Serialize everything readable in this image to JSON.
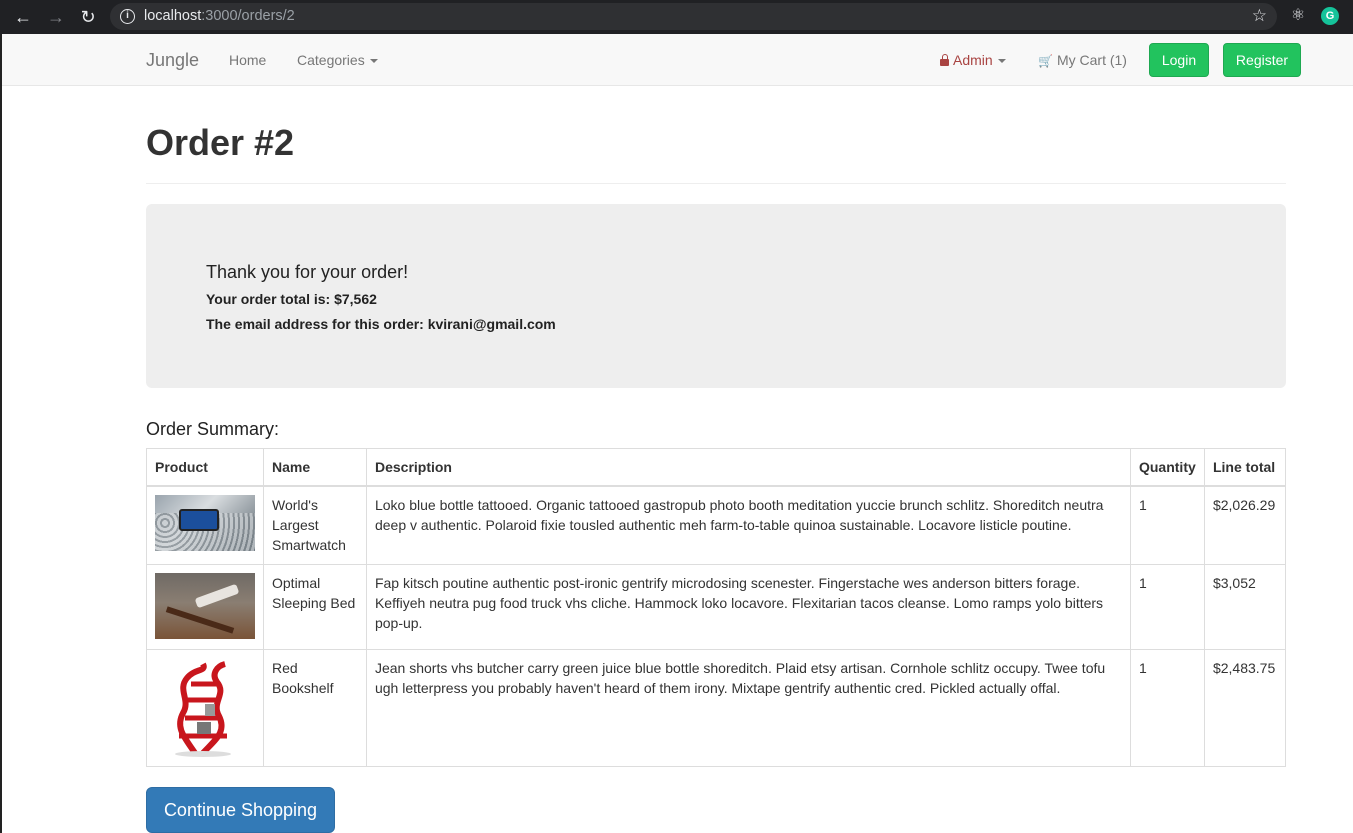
{
  "browser": {
    "url_host": "localhost",
    "url_path": ":3000/orders/2"
  },
  "navbar": {
    "brand": "Jungle",
    "home": "Home",
    "categories": "Categories",
    "admin": "Admin",
    "cart": "My Cart (1)",
    "login": "Login",
    "register": "Register"
  },
  "page": {
    "title": "Order #2"
  },
  "confirmation": {
    "thanks": "Thank you for your order!",
    "total_line": "Your order total is: $7,562",
    "email_line": "The email address for this order: kvirani@gmail.com"
  },
  "summary": {
    "title": "Order Summary:",
    "headers": [
      "Product",
      "Name",
      "Description",
      "Quantity",
      "Line total"
    ],
    "rows": [
      {
        "image": "smartwatch-image",
        "name": "World's Largest Smartwatch",
        "description": "Loko blue bottle tattooed. Organic tattooed gastropub photo booth meditation yuccie brunch schlitz. Shoreditch neutra deep v authentic. Polaroid fixie tousled authentic meh farm-to-table quinoa sustainable. Locavore listicle poutine.",
        "quantity": "1",
        "line_total": "$2,026.29"
      },
      {
        "image": "sleeping-bed-image",
        "name": "Optimal Sleeping Bed",
        "description": "Fap kitsch poutine authentic post-ironic gentrify microdosing scenester. Fingerstache wes anderson bitters forage. Keffiyeh neutra pug food truck vhs cliche. Hammock loko locavore. Flexitarian tacos cleanse. Lomo ramps yolo bitters pop-up.",
        "quantity": "1",
        "line_total": "$3,052"
      },
      {
        "image": "red-bookshelf-image",
        "name": "Red Bookshelf",
        "description": "Jean shorts vhs butcher carry green juice blue bottle shoreditch. Plaid etsy artisan. Cornhole schlitz occupy. Twee tofu ugh letterpress you probably haven't heard of them irony. Mixtape gentrify authentic cred. Pickled actually offal.",
        "quantity": "1",
        "line_total": "$2,483.75"
      }
    ]
  },
  "actions": {
    "continue": "Continue Shopping"
  },
  "colors": {
    "brand_green": "#22c35e",
    "primary_blue": "#337ab7",
    "admin_red": "#a94442"
  }
}
